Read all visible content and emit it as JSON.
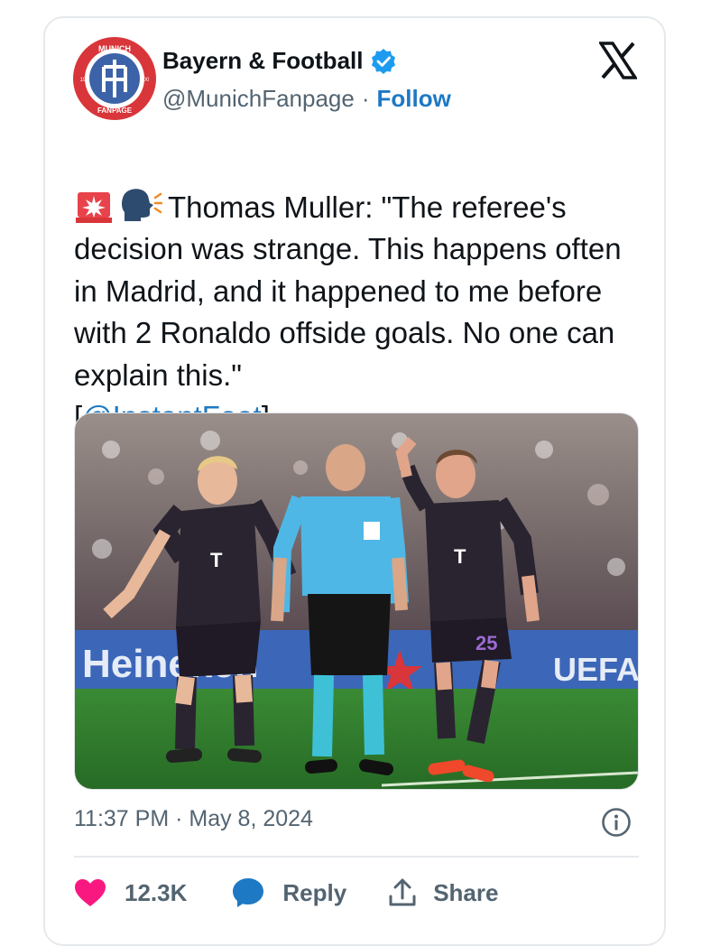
{
  "account": {
    "display_name": "Bayern & Football",
    "handle": "@MunichFanpage",
    "separator": "·",
    "follow_label": "Follow",
    "avatar": {
      "top_text": "MUNICH",
      "bottom_text": "FANPAGE",
      "left_num": "19",
      "right_num": "00"
    }
  },
  "tweet": {
    "emojis": [
      "rotating-light-emoji",
      "speaking-head-emoji"
    ],
    "text": "Thomas Muller: \"The referee's decision was strange. This happens often in Madrid, and it happened to me before with 2 Ronaldo offside goals. No one can explain this.\"",
    "bracket_open": "[",
    "mention": "@InstantFoot",
    "bracket_close": "]"
  },
  "photo": {
    "stadium_ad_left": "Heineken",
    "stadium_ad_right": "UEFA",
    "jersey_sponsor": "T",
    "jersey_number": "25"
  },
  "meta": {
    "timestamp": "11:37 PM · May 8, 2024"
  },
  "actions": {
    "like_count": "12.3K",
    "reply_label": "Reply",
    "share_label": "Share"
  },
  "colors": {
    "accent": "#1d79c4",
    "like": "#f91880",
    "muted": "#536471",
    "badge_red": "#d8363a",
    "pitch": "#2f7d2e",
    "kit_dark": "#2a2430",
    "referee_shirt": "#4fb7e6"
  }
}
